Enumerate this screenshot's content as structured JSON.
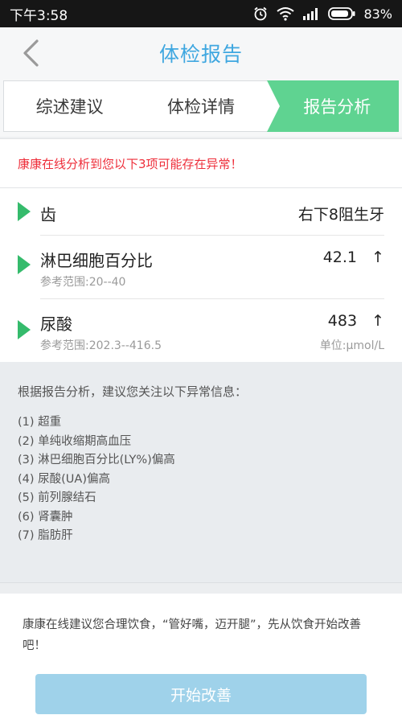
{
  "status": {
    "time": "下午3:58",
    "battery": "83%"
  },
  "nav": {
    "title": "体检报告"
  },
  "tabs": [
    {
      "label": "综述建议"
    },
    {
      "label": "体检详情"
    },
    {
      "label": "报告分析"
    }
  ],
  "alert": {
    "text": "康康在线分析到您以下3项可能存在异常！"
  },
  "items": [
    {
      "name": "齿",
      "value": "右下8阻生牙"
    },
    {
      "name": "淋巴细胞百分比",
      "value": "42.1",
      "arrow": "↑",
      "ref": "参考范围:20--40"
    },
    {
      "name": "尿酸",
      "value": "483",
      "arrow": "↑",
      "ref": "参考范围:202.3--416.5",
      "unit": "单位:μmol/L"
    }
  ],
  "analysis": {
    "intro": "根据报告分析，建议您关注以下异常信息：",
    "list": [
      "(1) 超重",
      "(2) 单纯收缩期高血压",
      "(3) 淋巴细胞百分比(LY%)偏高",
      "(4) 尿酸(UA)偏高",
      "(5) 前列腺结石",
      "(6) 肾囊肿",
      "(7) 脂肪肝"
    ]
  },
  "advice": {
    "text": "康康在线建议您合理饮食，“管好嘴，迈开腿”，先从饮食开始改善吧！",
    "button": "开始改善"
  },
  "colors": {
    "accent_blue": "#3fa7e0",
    "tab_active_green": "#5fd391",
    "alert_red": "#ee2e3a",
    "marker_green": "#35bb6c",
    "button_blue": "#9fd2ea"
  }
}
